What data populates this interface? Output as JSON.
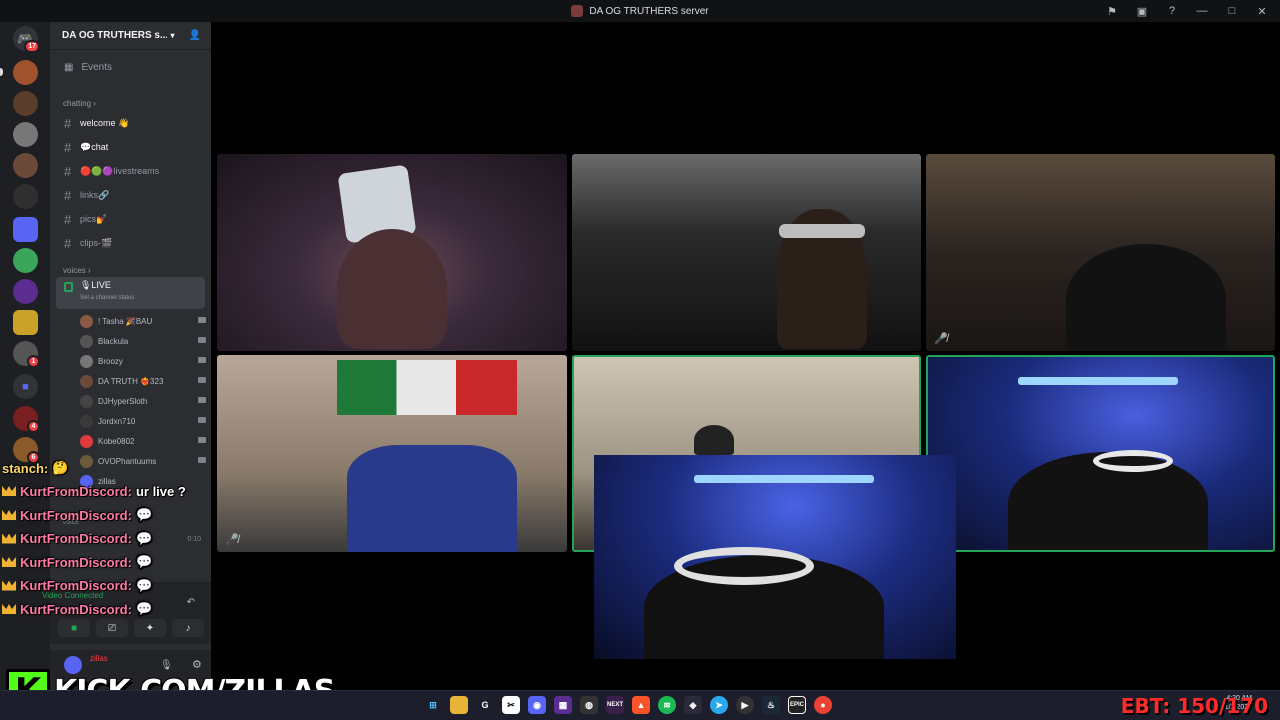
{
  "window": {
    "title": "DA OG TRUTHERS server"
  },
  "rail": {
    "home_badge": "17",
    "servers": [
      {
        "name": "server-1",
        "color": "#a0522d"
      },
      {
        "name": "server-2",
        "color": "#5a3e2b"
      },
      {
        "name": "server-3",
        "color": "#777"
      },
      {
        "name": "server-4",
        "color": "#6b4a3a"
      },
      {
        "name": "server-5",
        "color": "#333"
      },
      {
        "name": "server-6",
        "color": "#5865f2"
      },
      {
        "name": "server-7",
        "color": "#3ba55c"
      },
      {
        "name": "server-8",
        "color": "#5c2d91"
      },
      {
        "name": "server-9",
        "color": "#c9a227"
      },
      {
        "name": "server-10",
        "color": "#555"
      },
      {
        "name": "server-11",
        "color": "#4e5058"
      },
      {
        "name": "server-12",
        "color": "#7a1f1f"
      },
      {
        "name": "server-13",
        "color": "#8b5a2b"
      }
    ],
    "badge_a": "1",
    "badge_b": "4",
    "badge_c": "6"
  },
  "sidebar": {
    "server_name": "DA OG TRUTHERS s...",
    "events": "Events",
    "category_chatting": "chatting",
    "channels": [
      {
        "name": "welcome 👋",
        "bright": true
      },
      {
        "name": "💬chat",
        "bright": true
      },
      {
        "name": "🔴🟢🟣livestreams",
        "bright": false
      },
      {
        "name": "links🔗",
        "bright": false
      },
      {
        "name": "pics💅",
        "bright": false
      },
      {
        "name": "clips-🎬",
        "bright": false
      }
    ],
    "category_voices": "Voices",
    "voice_channel": {
      "name": "🎙LIVE",
      "status": "Set a channel status"
    },
    "voice_users": [
      {
        "name": "! Tasha 🎉BAU",
        "color": "#8a5a44"
      },
      {
        "name": "Blackula",
        "color": "#555"
      },
      {
        "name": "Broozy",
        "color": "#777"
      },
      {
        "name": "DA TRUTH ❤️‍🔥323",
        "color": "#6b4a3a"
      },
      {
        "name": "DJHyperSloth",
        "color": "#444"
      },
      {
        "name": "Jordxn710",
        "color": "#3a3a3a"
      },
      {
        "name": "Kobe0802",
        "color": "#e0393e"
      },
      {
        "name": "OVOPhantuums",
        "color": "#6b5b3a"
      },
      {
        "name": "zillas",
        "color": "#5865f2"
      }
    ],
    "voice_label": "Voice",
    "voice_time": "0:10",
    "video_connected": "Video Connected",
    "user_name": "zillas"
  },
  "chat_overlay": {
    "messages": [
      {
        "name": "stanch:",
        "text": "🤔",
        "yellow": true,
        "crown": false
      },
      {
        "name": "KurtFromDiscord:",
        "text": "ur live ?",
        "yellow": false,
        "crown": true
      },
      {
        "name": "KurtFromDiscord:",
        "text": "💬",
        "yellow": false,
        "crown": true
      },
      {
        "name": "KurtFromDiscord:",
        "text": "💬",
        "yellow": false,
        "crown": true
      },
      {
        "name": "KurtFromDiscord:",
        "text": "💬",
        "yellow": false,
        "crown": true
      },
      {
        "name": "KurtFromDiscord:",
        "text": "💬",
        "yellow": false,
        "crown": true
      },
      {
        "name": "KurtFromDiscord:",
        "text": "💬",
        "yellow": false,
        "crown": true
      }
    ]
  },
  "kick_banner": {
    "logo_letter": "K",
    "url": "KICK.COM/ZILLAS"
  },
  "taskbar": {
    "ebt_text": "EBT: 150/170",
    "time": "4:20 AM",
    "date": "1/1/2024"
  }
}
